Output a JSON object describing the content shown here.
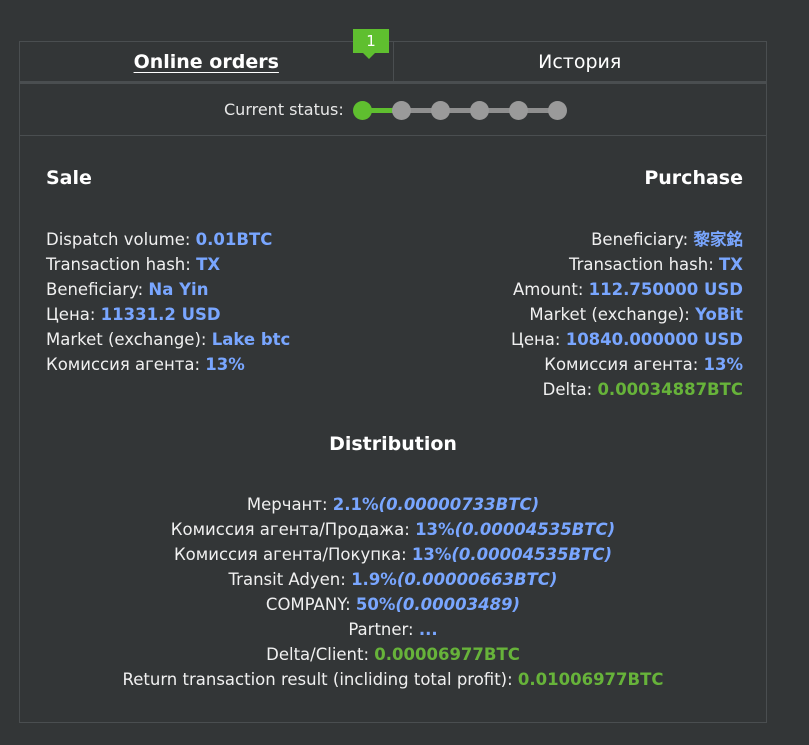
{
  "tabs": {
    "online_orders": "Online orders",
    "history": "История"
  },
  "status": {
    "label": "Current status:",
    "current_step": "1",
    "total_steps": 6
  },
  "sale": {
    "title": "Sale",
    "fields": [
      {
        "label": "Dispatch volume: ",
        "value": "0.01BTC"
      },
      {
        "label": "Transaction hash: ",
        "value": "TX"
      },
      {
        "label": "Beneficiary: ",
        "value": "Na Yin"
      },
      {
        "label": "Цена: ",
        "value": "11331.2 USD"
      },
      {
        "label": "Market (exchange): ",
        "value": "Lake btc"
      },
      {
        "label": "Комиссия агента: ",
        "value": "13%"
      }
    ]
  },
  "purchase": {
    "title": "Purchase",
    "fields": [
      {
        "label": "Beneficiary: ",
        "value": "黎家銘"
      },
      {
        "label": "Transaction hash: ",
        "value": "TX"
      },
      {
        "label": "Amount: ",
        "value": "112.750000 USD"
      },
      {
        "label": "Market (exchange): ",
        "value": "YoBit"
      },
      {
        "label": "Цена: ",
        "value": "10840.000000 USD"
      },
      {
        "label": "Комиссия агента: ",
        "value": "13%"
      },
      {
        "label": "Delta: ",
        "value": "0.00034887BTC"
      }
    ]
  },
  "distribution": {
    "title": "Distribution",
    "rows": [
      {
        "label": "Мерчант: ",
        "value": "2.1%",
        "extra": "(0.00000733BTC)"
      },
      {
        "label": "Комиссия агента/Продажа: ",
        "value": "13%",
        "extra": "(0.00004535BTC)"
      },
      {
        "label": "Комиссия агента/Покупка: ",
        "value": "13%",
        "extra": "(0.00004535BTC)"
      },
      {
        "label": "Transit Adyen: ",
        "value": "1.9%",
        "extra": "(0.00000663BTC)"
      },
      {
        "label": "COMPANY: ",
        "value": "50%",
        "extra": "(0.00003489)"
      },
      {
        "label": "Partner: ",
        "value": "...",
        "extra": ""
      },
      {
        "label": "Delta/Client: ",
        "value": "0.00006977BTC",
        "extra": ""
      },
      {
        "label": "Return transaction result (incliding total profit): ",
        "value": "0.01006977BTC",
        "extra": ""
      }
    ]
  },
  "colors": {
    "background": "#333637",
    "accent_blue": "#79a6ff",
    "accent_green": "#67b33a",
    "step_active": "#5fbf2f",
    "step_inactive": "#9a9a9a"
  }
}
